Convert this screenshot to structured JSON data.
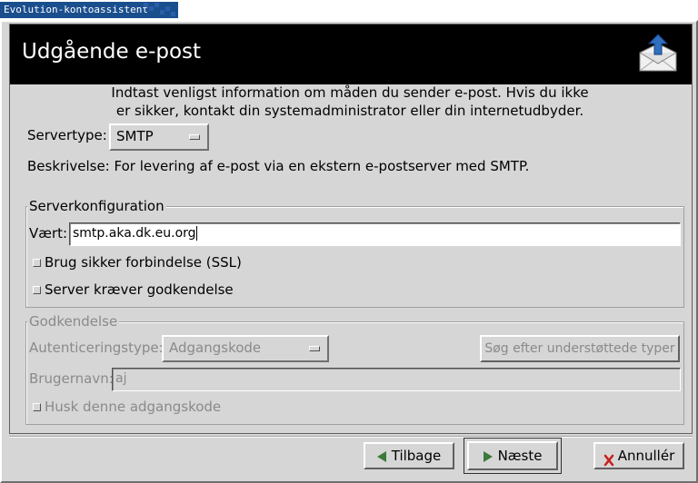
{
  "window": {
    "title": "Evolution-kontoassistent"
  },
  "page": {
    "heading": "Udgående e-post",
    "intro_line1": "Indtast venligst information om måden du sender e-post. Hvis du ikke",
    "intro_line2": "er sikker, kontakt din systemadministrator eller din internetudbyder."
  },
  "server_type": {
    "label": "Servertype:",
    "value": "SMTP"
  },
  "description": {
    "text": "Beskrivelse: For levering af e-post via en ekstern e-postserver med SMTP."
  },
  "server_config": {
    "title": "Serverkonfiguration",
    "host_label": "Vært:",
    "host_value": "smtp.aka.dk.eu.org",
    "ssl_label": "Brug sikker forbindelse (SSL)",
    "ssl_checked": false,
    "auth_required_label": "Server kræver godkendelse",
    "auth_required_checked": false
  },
  "authentication": {
    "title": "Godkendelse",
    "auth_type_label": "Autenticeringstype:",
    "auth_type_value": "Adgangskode",
    "check_types_button": "Søg efter understøttede typer",
    "username_label": "Brugernavn:",
    "username_value": "aj",
    "remember_label": "Husk denne adgangskode",
    "remember_checked": false
  },
  "buttons": {
    "back": "Tilbage",
    "next": "Næste",
    "cancel": "Annullér"
  },
  "colors": {
    "title_tab_bg": "#1a4f8e",
    "header_bg": "#000000",
    "dialog_bg": "#d6d6d6",
    "disabled_text": "#8a8a8a",
    "cancel_icon": "#c81e1e"
  }
}
